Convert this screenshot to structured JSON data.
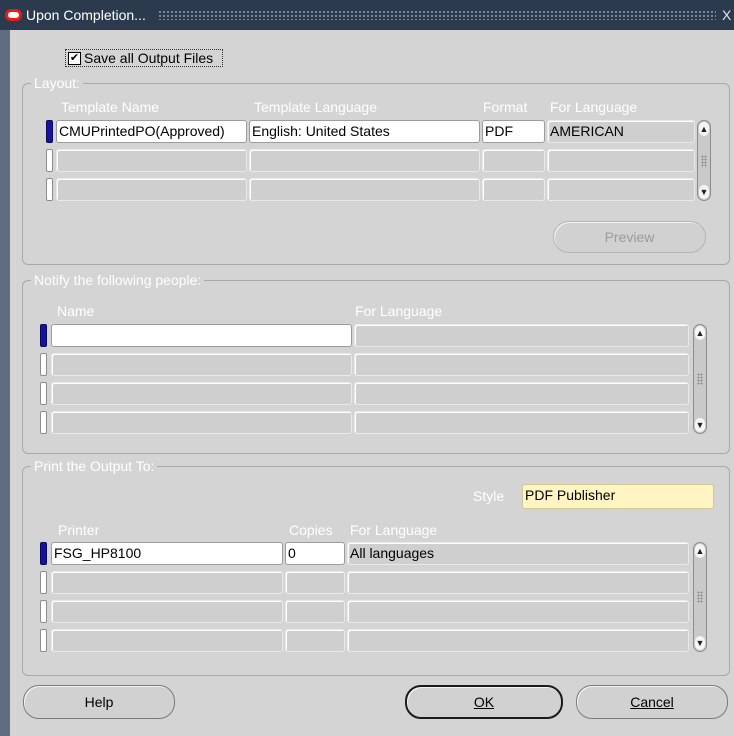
{
  "window": {
    "title": "Upon Completion...",
    "close_glyph": "X"
  },
  "save_outputs": {
    "label": "Save all Output Files",
    "checked": true,
    "check_glyph": "☑"
  },
  "layout": {
    "legend": "Layout:",
    "headers": [
      "Template Name",
      "Template Language",
      "Format",
      "For Language"
    ],
    "rows": [
      [
        "CMUPrintedPO(Approved)",
        "English: United States",
        "PDF",
        "AMERICAN"
      ],
      [
        "",
        "",
        "",
        ""
      ],
      [
        "",
        "",
        "",
        ""
      ]
    ],
    "preview_label": "Preview"
  },
  "notify": {
    "legend": "Notify the following people:",
    "headers": [
      "Name",
      "For Language"
    ],
    "rows": [
      [
        "",
        ""
      ],
      [
        "",
        ""
      ],
      [
        "",
        ""
      ],
      [
        "",
        ""
      ]
    ]
  },
  "print": {
    "legend": "Print the Output To:",
    "style_label": "Style",
    "style_value": "PDF Publisher",
    "headers": [
      "Printer",
      "Copies",
      "For Language"
    ],
    "rows": [
      [
        "FSG_HP8100",
        "0",
        "All languages"
      ],
      [
        "",
        "",
        ""
      ],
      [
        "",
        "",
        ""
      ],
      [
        "",
        "",
        ""
      ]
    ]
  },
  "buttons": {
    "help": "Help",
    "ok": "OK",
    "cancel": "Cancel"
  },
  "colors": {
    "titlebar": "#2c3a4e",
    "dialog_bg": "#d4d4d4",
    "active_row": "#16149c",
    "style_field": "#fff5c2"
  }
}
